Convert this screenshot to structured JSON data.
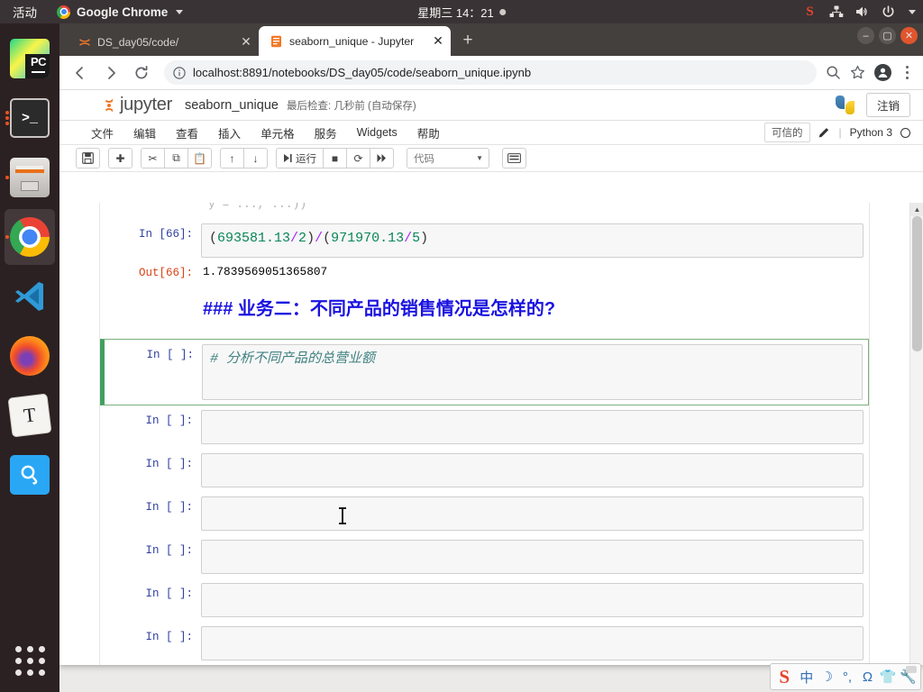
{
  "os_topbar": {
    "activities": "活动",
    "app_name": "Google Chrome",
    "clock": "星期三 14：21",
    "tray": [
      "sogou-tray",
      "network-icon",
      "volume-icon",
      "power-icon",
      "caret-down-icon"
    ]
  },
  "dock": {
    "items": [
      {
        "name": "pycharm",
        "label": "PC",
        "running": false,
        "active": false
      },
      {
        "name": "terminal",
        "label": ">_",
        "running": true,
        "active": false
      },
      {
        "name": "files",
        "label": "",
        "running": true,
        "active": false
      },
      {
        "name": "google-chrome",
        "label": "",
        "running": true,
        "active": true
      },
      {
        "name": "vscode",
        "label": "",
        "running": false,
        "active": false
      },
      {
        "name": "firefox",
        "label": "",
        "running": false,
        "active": false
      },
      {
        "name": "text-editor",
        "label": "T",
        "running": false,
        "active": false
      },
      {
        "name": "search-app",
        "label": "Q",
        "running": false,
        "active": false
      }
    ],
    "show_apps": "show-applications-grid"
  },
  "browser": {
    "tabs": [
      {
        "title": "DS_day05/code/",
        "favicon": "jupyter-logo-icon",
        "active": false
      },
      {
        "title": "seaborn_unique - Jupyter",
        "favicon": "notebook-icon",
        "active": true
      }
    ],
    "new_tab_label": "+",
    "close_label": "✕",
    "nav": {
      "back": "←",
      "forward": "→",
      "reload": "⟳"
    },
    "url_host": "localhost:8891",
    "url_path": "/notebooks/DS_day05/code/seaborn_unique.ipynb",
    "url_full": "localhost:8891/notebooks/DS_day05/code/seaborn_unique.ipynb",
    "window_controls": {
      "minimize": "–",
      "maximize": "▢",
      "close": "✕"
    }
  },
  "jupyter": {
    "brand": "jupyter",
    "notebook_name": "seaborn_unique",
    "checkpoint": "最后检查: 几秒前  (自动保存)",
    "logout_label": "注销",
    "menus": [
      "文件",
      "编辑",
      "查看",
      "插入",
      "单元格",
      "服务",
      "Widgets",
      "帮助"
    ],
    "trusted_label": "可信的",
    "kernel_name": "Python 3",
    "toolbar": {
      "save": "💾",
      "insert_below": "✚",
      "cut": "✂",
      "copy": "⧉",
      "paste": "📋",
      "move_up": "↑",
      "move_down": "↓",
      "run_label": "运行",
      "interrupt": "■",
      "restart": "⟳",
      "restart_run_all": "⏭",
      "cell_type": "代码",
      "command_palette": "⌨"
    }
  },
  "notebook": {
    "truncated_top_text": "y = ..., ...))",
    "cells": [
      {
        "type": "code",
        "prompt": "In [66]:",
        "source_tokens": [
          {
            "t": "(",
            "c": "paren"
          },
          {
            "t": "693581.13",
            "c": "num"
          },
          {
            "t": "/",
            "c": "op"
          },
          {
            "t": "2",
            "c": "num"
          },
          {
            "t": ")",
            "c": "paren"
          },
          {
            "t": "/",
            "c": "op"
          },
          {
            "t": "(",
            "c": "paren"
          },
          {
            "t": "971970.13",
            "c": "num"
          },
          {
            "t": "/",
            "c": "op"
          },
          {
            "t": "5",
            "c": "num"
          },
          {
            "t": ")",
            "c": "paren"
          }
        ],
        "source_plain": "(693581.13/2)/(971970.13/5)",
        "output_prompt": "Out[66]:",
        "output": "1.7839569051365807"
      },
      {
        "type": "markdown",
        "rendered": "### 业务二：不同产品的销售情况是怎样的?"
      },
      {
        "type": "code",
        "prompt": "In [ ]:",
        "source_plain": "# 分析不同产品的总营业额",
        "selected": true
      },
      {
        "type": "code",
        "prompt": "In [ ]:",
        "source_plain": ""
      },
      {
        "type": "code",
        "prompt": "In [ ]:",
        "source_plain": ""
      },
      {
        "type": "code",
        "prompt": "In [ ]:",
        "source_plain": ""
      },
      {
        "type": "code",
        "prompt": "In [ ]:",
        "source_plain": ""
      },
      {
        "type": "code",
        "prompt": "In [ ]:",
        "source_plain": ""
      },
      {
        "type": "code",
        "prompt": "In [ ]:",
        "source_plain": ""
      }
    ]
  },
  "ime": {
    "brand": "S",
    "buttons": [
      "中",
      "☽",
      "°,",
      "Ω",
      "👕",
      "🔧"
    ],
    "names": [
      "chinese-mode-icon",
      "moon-icon",
      "punctuation-icon",
      "symbol-icon",
      "skin-icon",
      "toolbox-icon"
    ]
  },
  "colors": {
    "accent_orange": "#f37726",
    "markdown_blue": "#1a12e0",
    "comment_green": "#408080",
    "selected_cell_green": "#42a05f",
    "prompt_blue": "#303f9f",
    "out_prompt_red": "#d84315"
  }
}
